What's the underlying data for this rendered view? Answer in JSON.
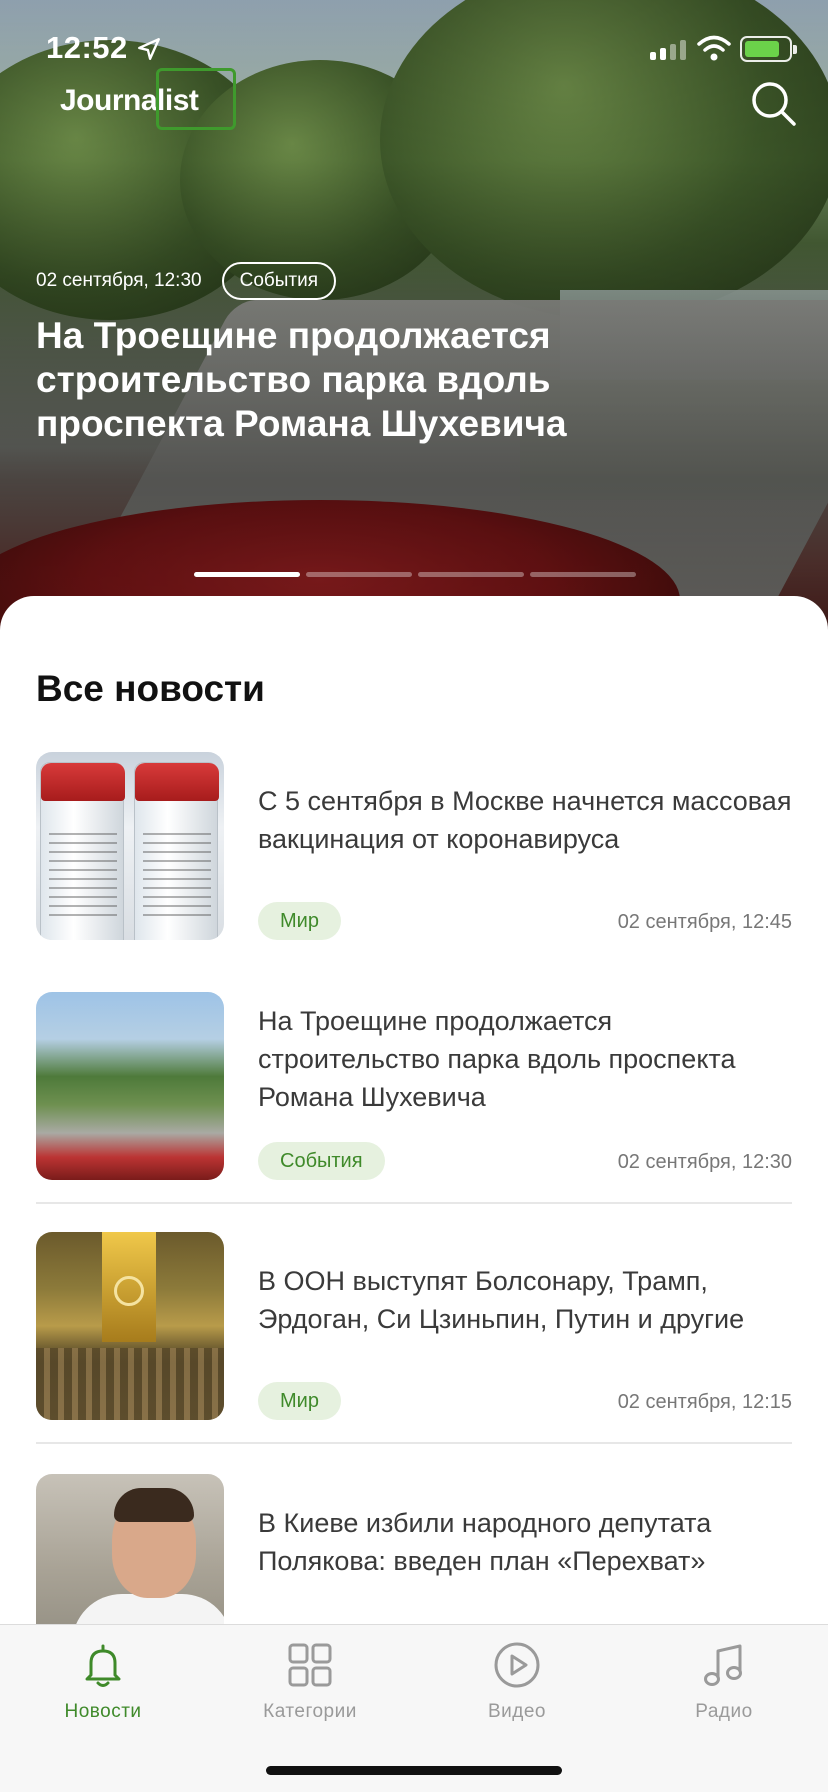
{
  "status_bar": {
    "time": "12:52"
  },
  "header": {
    "logo": "Journalist"
  },
  "hero": {
    "date": "02 сентября, 12:30",
    "tag": "События",
    "title": "На Троещине продолжается строительство парка вдоль проспекта Романа Шухевича",
    "pager": {
      "count": 4,
      "active": 0
    }
  },
  "section_title": "Все новости",
  "news": [
    {
      "title": "С 5 сентября в Москве начнется массовая вакцинация от коронавируса",
      "tag": "Мир",
      "date": "02 сентября, 12:45",
      "thumb": "vaccine"
    },
    {
      "title": "На Троещине продолжается строительство парка вдоль проспекта Романа Шухевича",
      "tag": "События",
      "date": "02 сентября, 12:30",
      "thumb": "park"
    },
    {
      "title": "В ООН выступят Болсонару, Трамп, Эрдоган, Си Цзиньпин, Путин и другие",
      "tag": "Мир",
      "date": "02 сентября, 12:15",
      "thumb": "un"
    },
    {
      "title": "В Киеве избили народного депутата Полякова: введен план «Перехват»",
      "thumb": "person"
    }
  ],
  "tabs": [
    {
      "label": "Новости",
      "icon": "bell-icon",
      "active": true
    },
    {
      "label": "Категории",
      "icon": "grid-icon",
      "active": false
    },
    {
      "label": "Видео",
      "icon": "play-icon",
      "active": false
    },
    {
      "label": "Радио",
      "icon": "music-note-icon",
      "active": false
    }
  ],
  "colors": {
    "accent": "#3f8a2a",
    "tag_bg": "#e6f1df",
    "inactive": "#9a9a9a"
  }
}
